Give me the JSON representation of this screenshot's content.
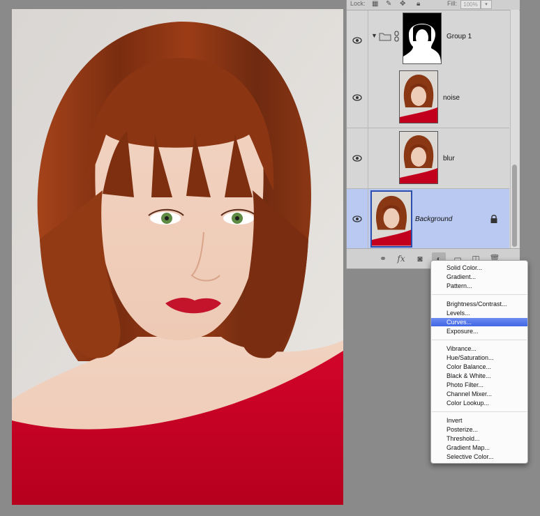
{
  "layers_panel": {
    "lock_label": "Lock:",
    "fill_label": "Fill:",
    "fill_value": "100%",
    "layers": [
      {
        "name": "Group 1",
        "italic": false,
        "selected": false,
        "expanded": true
      },
      {
        "name": "noise",
        "italic": false,
        "selected": false
      },
      {
        "name": "blur",
        "italic": false,
        "selected": false
      },
      {
        "name": "Background",
        "italic": true,
        "selected": true,
        "locked": true
      }
    ],
    "footer_icons": [
      "link-icon",
      "fx-icon",
      "mask-icon",
      "adjustment-icon",
      "folder-icon",
      "new-layer-icon",
      "trash-icon"
    ],
    "fx_label": "fx"
  },
  "adjustment_menu": {
    "groups": [
      [
        "Solid Color...",
        "Gradient...",
        "Pattern..."
      ],
      [
        "Brightness/Contrast...",
        "Levels...",
        "Curves...",
        "Exposure..."
      ],
      [
        "Vibrance...",
        "Hue/Saturation...",
        "Color Balance...",
        "Black & White...",
        "Photo Filter...",
        "Channel Mixer...",
        "Color Lookup..."
      ],
      [
        "Invert",
        "Posterize...",
        "Threshold...",
        "Gradient Map...",
        "Selective Color..."
      ]
    ],
    "highlighted": "Curves..."
  },
  "colors": {
    "selection": "#b9c9f2",
    "menu_highlight": "#4a6ee8",
    "shirt_red": "#c4001f",
    "hair": "#8e3a12"
  }
}
